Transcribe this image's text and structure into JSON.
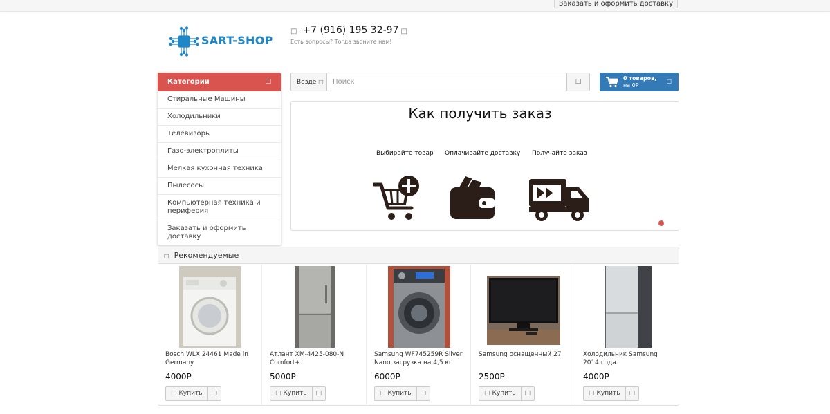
{
  "topbar": {
    "order_button": "Заказать и оформить доставку"
  },
  "header": {
    "logo_text": "SART-SHOP",
    "phone": "+7 (916) 195 32-97",
    "phone_hint": "Есть вопросы? Тогда звоните нам!"
  },
  "categories": {
    "title": "Категории",
    "items": [
      "Стиральные Машины",
      "Холодильники",
      "Телевизоры",
      "Газо-электроплиты",
      "Мелкая кухонная техника",
      "Пылесосы",
      "Компьютерная техника и периферия",
      "Заказать и оформить доставку"
    ]
  },
  "search": {
    "scope": "Везде",
    "placeholder": "Поиск"
  },
  "cart": {
    "count_label": "0 товаров,",
    "sum_label": "на 0Р"
  },
  "banner": {
    "title": "Как получить заказ",
    "steps": [
      "Выбирайте товар",
      "Оплачивайте доставку",
      "Получайте заказ"
    ]
  },
  "recommended": {
    "title": "Рекомендуемые",
    "buy_label": "Купить",
    "products": [
      {
        "name": "Bosch WLX 24461 Made in Germany",
        "price": "4000Р"
      },
      {
        "name": "Атлант ХМ-4425-080-N Comfort+.",
        "price": "5000Р"
      },
      {
        "name": "Samsung WF745259R Silver Nano загрузка на 4,5 кг",
        "price": "6000Р"
      },
      {
        "name": "Samsung оснащенный 27",
        "price": "2500Р"
      },
      {
        "name": "Холодильник Samsung 2014 года.",
        "price": "4000Р"
      }
    ]
  },
  "colors": {
    "category_header": "#d9534f",
    "cart_button": "#337ab7",
    "logo": "#1f86c8"
  }
}
